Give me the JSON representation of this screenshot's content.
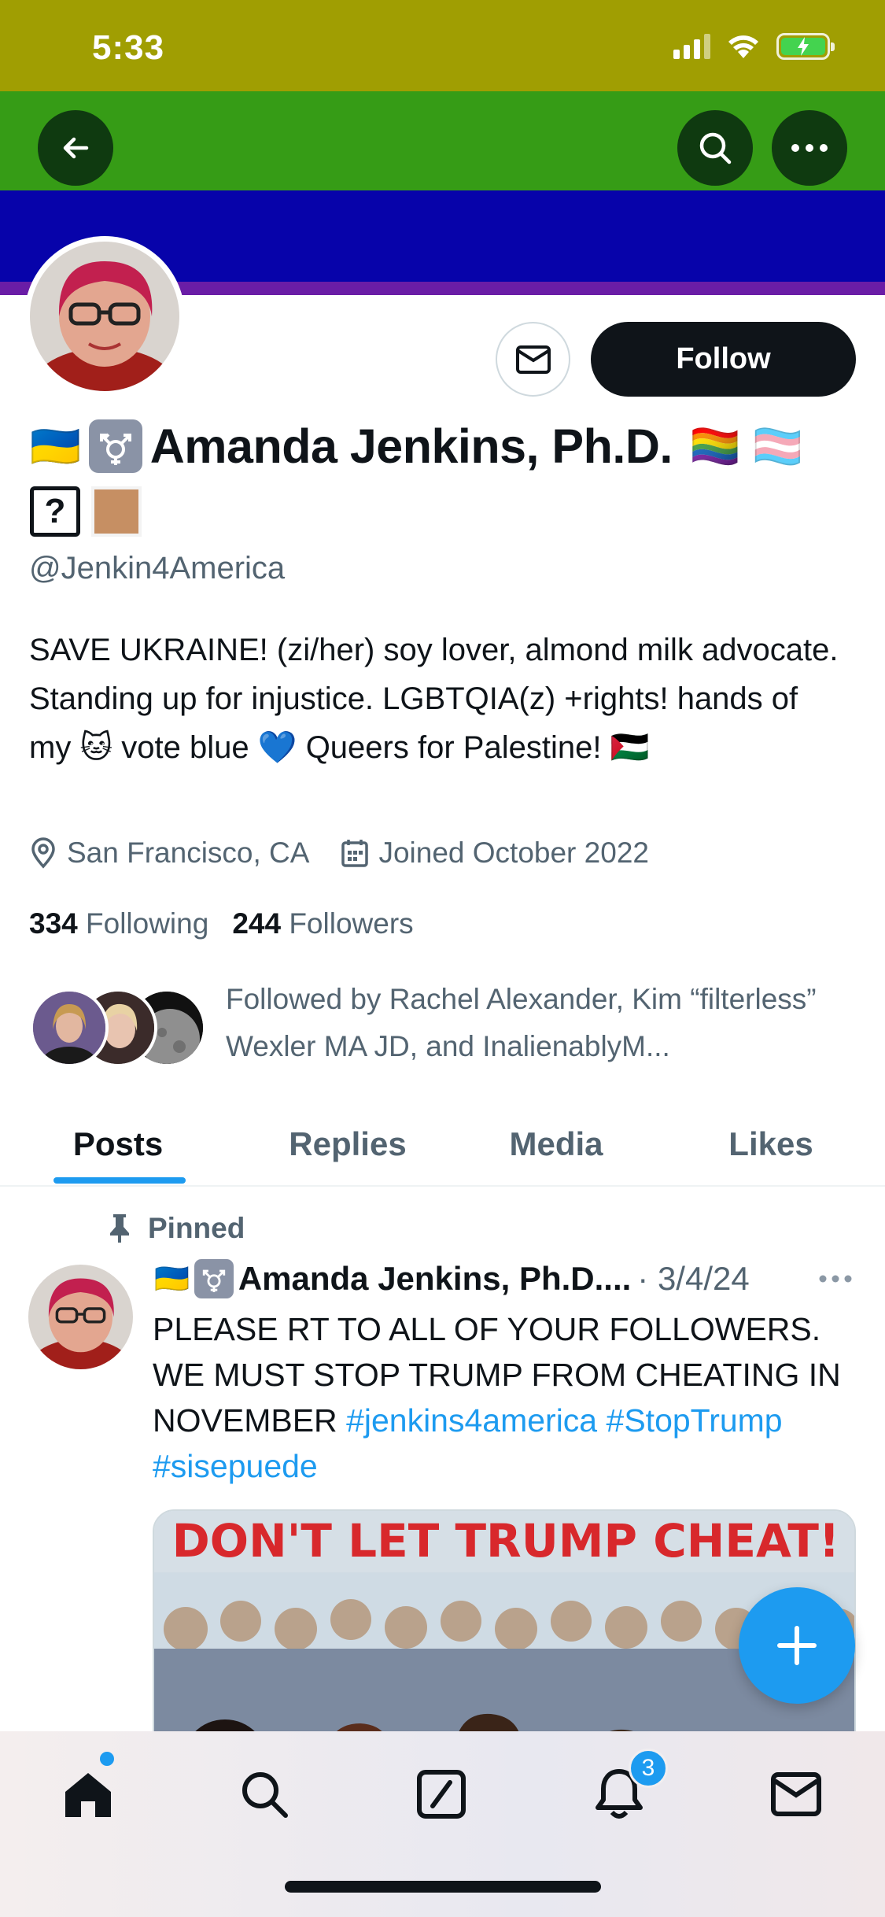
{
  "status_bar": {
    "time": "5:33"
  },
  "header": {
    "back_icon": "arrow-left-icon",
    "search_icon": "search-icon",
    "more_icon": "more-dots-icon"
  },
  "profile": {
    "flag_emoji": "🇺🇦",
    "symbol_emoji": "⚧️",
    "display_name": "Amanda Jenkins, Ph.D.",
    "trailing_emojis": "🏳️‍🌈 🏳️‍⚧️",
    "second_line_emoji_1": "?",
    "handle": "@Jenkin4America",
    "bio_part_1": "SAVE UKRAINE! (zi/her) soy lover, almond milk advocate. Standing up for injustice. LGBTQIA(z) +rights! hands of my",
    "bio_emoji_cat": "🐱",
    "bio_part_2": "vote blue",
    "bio_emoji_heart": "💙",
    "bio_part_3": "Queers for Palestine!",
    "bio_emoji_flag": "🇵🇸",
    "location": "San Francisco, CA",
    "joined": "Joined October 2022",
    "following_count": "334",
    "following_label": "Following",
    "followers_count": "244",
    "followers_label": "Followers",
    "followed_by": "Followed by Rachel Alexander, Kim “filterless” Wexler MA JD, and InalienablyM..."
  },
  "actions": {
    "follow_label": "Follow"
  },
  "tabs": [
    {
      "label": "Posts",
      "active": true
    },
    {
      "label": "Replies",
      "active": false
    },
    {
      "label": "Media",
      "active": false
    },
    {
      "label": "Likes",
      "active": false
    }
  ],
  "pinned_post": {
    "pinned_label": "Pinned",
    "flag_emoji": "🇺🇦",
    "symbol_emoji": "⚧️",
    "author_name": "Amanda Jenkins, Ph.D....",
    "date": "· 3/4/24",
    "text": "PLEASE RT TO ALL OF YOUR FOLLOWERS. WE MUST STOP TRUMP FROM CHEATING IN NOVEMBER",
    "hashtags": [
      "#jenkins4america",
      "#StopTrump",
      "#sisepuede"
    ],
    "image_caption": "DON'T LET TRUMP CHEAT!"
  },
  "bottom_nav": {
    "items": [
      "home-icon",
      "search-icon",
      "compose-icon",
      "notifications-icon",
      "messages-icon"
    ],
    "notification_count": "3"
  },
  "colors": {
    "banner_stripes": [
      "#a09e02",
      "#369c16",
      "#0703aa",
      "#6a1da6"
    ],
    "accent": "#1d9bf0",
    "text_primary": "#0f1419",
    "text_secondary": "#536471"
  }
}
